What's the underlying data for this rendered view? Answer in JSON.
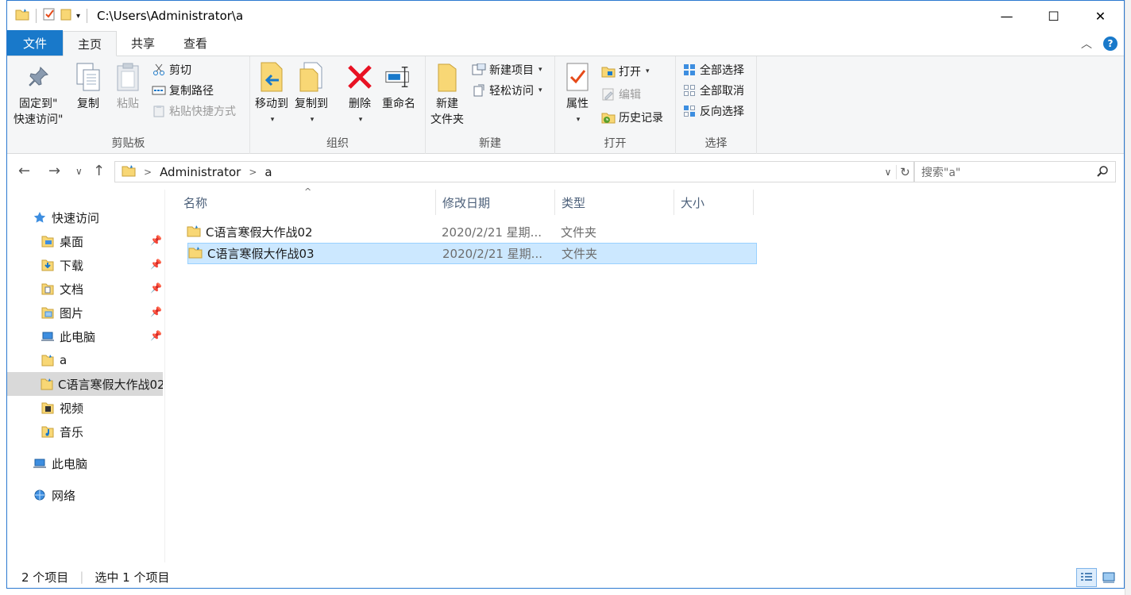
{
  "window": {
    "title_path": "C:\\Users\\Administrator\\a",
    "controls": {
      "minimize": "—",
      "maximize": "☐",
      "close": "✕"
    }
  },
  "tabs": [
    {
      "label": "文件"
    },
    {
      "label": "主页"
    },
    {
      "label": "共享"
    },
    {
      "label": "查看"
    }
  ],
  "ribbon": {
    "clipboard": {
      "label": "剪贴板",
      "pin_line1": "固定到\"",
      "pin_line2": "快速访问\"",
      "copy": "复制",
      "paste": "粘贴",
      "cut": "剪切",
      "copy_path": "复制路径",
      "paste_shortcut": "粘贴快捷方式"
    },
    "organize": {
      "label": "组织",
      "move_to": "移动到",
      "copy_to": "复制到",
      "delete": "删除",
      "rename": "重命名"
    },
    "new": {
      "label": "新建",
      "new_folder_line1": "新建",
      "new_folder_line2": "文件夹",
      "new_item": "新建项目",
      "easy_access": "轻松访问"
    },
    "open": {
      "label": "打开",
      "properties": "属性",
      "open": "打开",
      "edit": "编辑",
      "history": "历史记录"
    },
    "select": {
      "label": "选择",
      "select_all": "全部选择",
      "select_none": "全部取消",
      "invert": "反向选择"
    }
  },
  "address": {
    "crumbs": [
      "Administrator",
      "a"
    ],
    "search_placeholder": "搜索\"a\""
  },
  "nav": {
    "quick_access": "快速访问",
    "items": [
      {
        "label": "桌面",
        "pinned": true
      },
      {
        "label": "下载",
        "pinned": true
      },
      {
        "label": "文档",
        "pinned": true
      },
      {
        "label": "图片",
        "pinned": true
      },
      {
        "label": "此电脑",
        "pinned": true
      },
      {
        "label": "a",
        "pinned": false
      },
      {
        "label": "C语言寒假大作战02",
        "pinned": false
      },
      {
        "label": "视频",
        "pinned": false
      },
      {
        "label": "音乐",
        "pinned": false
      }
    ],
    "this_pc": "此电脑",
    "network": "网络"
  },
  "columns": {
    "name": "名称",
    "date": "修改日期",
    "type": "类型",
    "size": "大小"
  },
  "files": [
    {
      "name": "C语言寒假大作战02",
      "date": "2020/2/21 星期...",
      "type": "文件夹",
      "size": ""
    },
    {
      "name": "C语言寒假大作战03",
      "date": "2020/2/21 星期...",
      "type": "文件夹",
      "size": ""
    }
  ],
  "status": {
    "count": "2 个项目",
    "selected": "选中 1 个项目"
  },
  "colors": {
    "accent": "#1979ca",
    "selection": "#cce8ff",
    "folder": "#f8d775",
    "delete_red": "#e81123"
  }
}
